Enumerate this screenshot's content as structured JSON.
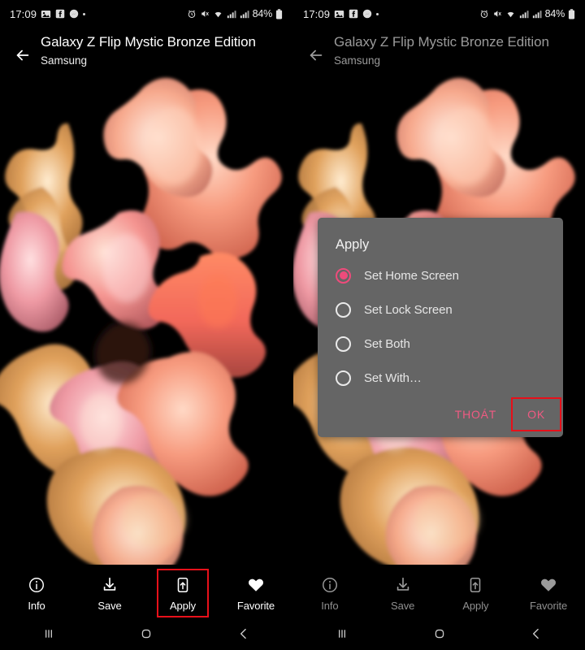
{
  "colors": {
    "background": "#000000",
    "accent_pink": "#ee4b7b",
    "dialog_bg": "#656565",
    "highlight_red": "#e8101a",
    "text_primary": "#ffffff",
    "text_dimmed": "#9a9a9a"
  },
  "status_bar": {
    "time": "17:09",
    "left_icons": [
      "photo-icon",
      "facebook-icon",
      "messenger-icon",
      "dot-indicator"
    ],
    "right_icons": [
      "alarm-icon",
      "mute-icon",
      "wifi-icon",
      "signal-icon",
      "signal-icon"
    ],
    "battery_percent": "84%",
    "battery_icon": "battery-icon"
  },
  "header": {
    "back_icon": "back-arrow-icon",
    "title": "Galaxy Z Flip Mystic Bronze Edition",
    "subtitle": "Samsung"
  },
  "wallpaper": {
    "alt": "abstract coral and pink petal bloom on black background"
  },
  "toolbar": {
    "items": [
      {
        "label": "Info",
        "icon": "info-icon",
        "highlighted": false
      },
      {
        "label": "Save",
        "icon": "download-icon",
        "highlighted": false
      },
      {
        "label": "Apply",
        "icon": "apply-phone-icon",
        "highlighted": true
      },
      {
        "label": "Favorite",
        "icon": "heart-icon",
        "highlighted": false
      }
    ]
  },
  "nav_bar": {
    "items": [
      {
        "name": "recents",
        "icon": "recents-bars-icon"
      },
      {
        "name": "home",
        "icon": "home-square-icon"
      },
      {
        "name": "back",
        "icon": "chevron-left-icon"
      }
    ]
  },
  "dialog": {
    "title": "Apply",
    "options": [
      {
        "label": "Set Home Screen",
        "selected": true
      },
      {
        "label": "Set Lock Screen",
        "selected": false
      },
      {
        "label": "Set Both",
        "selected": false
      },
      {
        "label": "Set With…",
        "selected": false
      }
    ],
    "cancel_label": "THOÁT",
    "confirm_label": "OK",
    "confirm_highlighted": true
  },
  "panels": [
    {
      "id": "left",
      "dimmed": false,
      "dialog_visible": false
    },
    {
      "id": "right",
      "dimmed": true,
      "dialog_visible": true
    }
  ]
}
